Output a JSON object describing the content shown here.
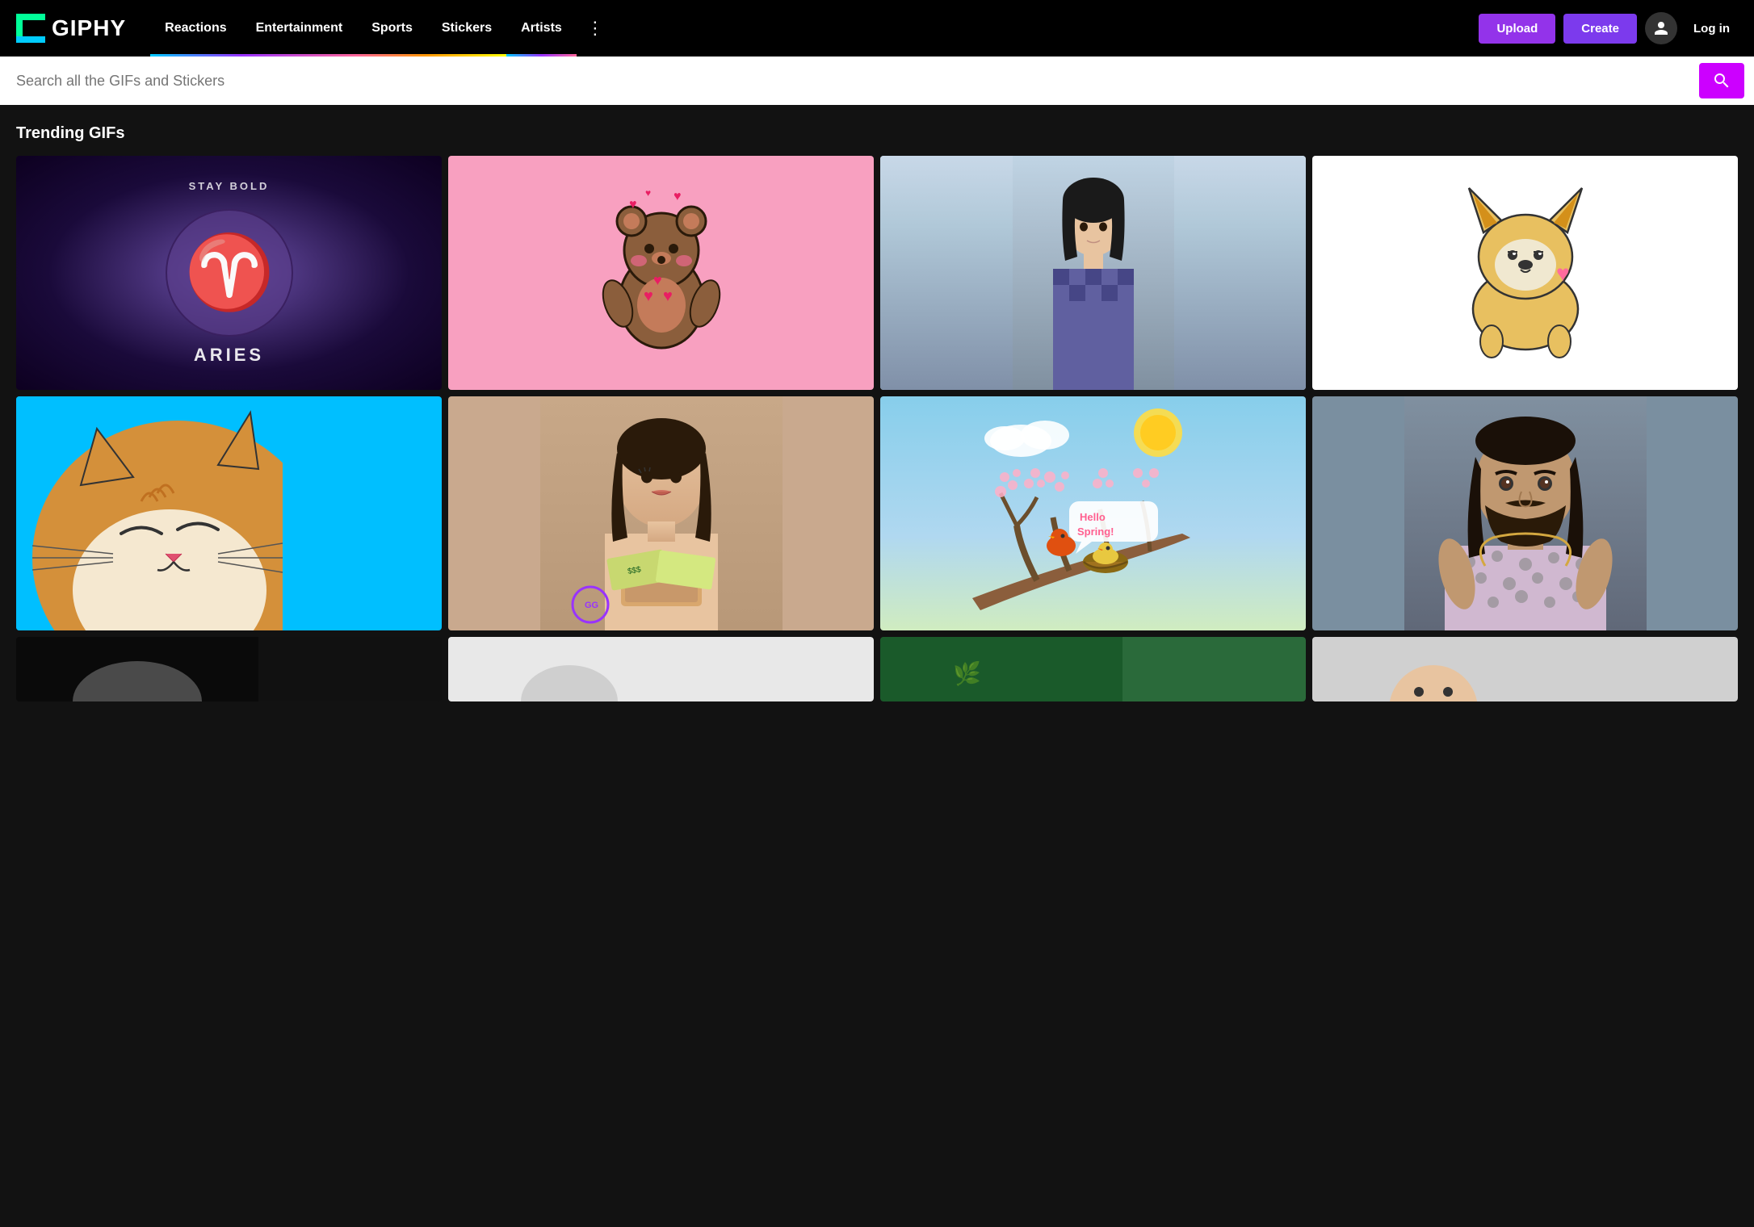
{
  "header": {
    "logo": "GIPHY",
    "nav": {
      "items": [
        {
          "id": "reactions",
          "label": "Reactions",
          "class": "reactions"
        },
        {
          "id": "entertainment",
          "label": "Entertainment",
          "class": "entertainment"
        },
        {
          "id": "sports",
          "label": "Sports",
          "class": "sports"
        },
        {
          "id": "stickers",
          "label": "Stickers",
          "class": "stickers"
        },
        {
          "id": "artists",
          "label": "Artists",
          "class": "artists"
        }
      ],
      "more": "⋮"
    },
    "actions": {
      "upload": "Upload",
      "create": "Create",
      "login": "Log in"
    }
  },
  "search": {
    "placeholder": "Search all the GIFs and Stickers"
  },
  "trending": {
    "title": "Trending GIFs",
    "gifs": [
      {
        "id": "gif-1",
        "alt": "Aries Stay Bold moon GIF"
      },
      {
        "id": "gif-2",
        "alt": "Cute bear with hearts GIF"
      },
      {
        "id": "gif-3",
        "alt": "Person looking GIF"
      },
      {
        "id": "gif-4",
        "alt": "Corgi dog with heart GIF"
      },
      {
        "id": "gif-5",
        "alt": "Sleeping cat on blue background GIF"
      },
      {
        "id": "gif-6",
        "alt": "Woman counting money GIF"
      },
      {
        "id": "gif-7",
        "alt": "Hello Spring bird illustration GIF"
      },
      {
        "id": "gif-8",
        "alt": "Man in polka dot shirt GIF"
      },
      {
        "id": "gif-9",
        "alt": "Partial GIF row 1"
      },
      {
        "id": "gif-10",
        "alt": "Partial GIF row 2"
      },
      {
        "id": "gif-11",
        "alt": "Partial GIF row 3"
      },
      {
        "id": "gif-12",
        "alt": "Partial GIF row 4"
      }
    ]
  },
  "icons": {
    "search": "🔍",
    "user": "👤",
    "more": "⋮"
  }
}
